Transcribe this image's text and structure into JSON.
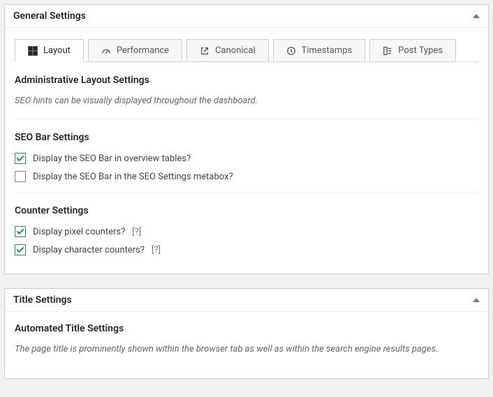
{
  "panels": {
    "general": {
      "title": "General Settings",
      "tabs": [
        {
          "label": "Layout"
        },
        {
          "label": "Performance"
        },
        {
          "label": "Canonical"
        },
        {
          "label": "Timestamps"
        },
        {
          "label": "Post Types"
        }
      ],
      "admin_layout": {
        "heading": "Administrative Layout Settings",
        "desc": "SEO hints can be visually displayed throughout the dashboard."
      },
      "seo_bar": {
        "heading": "SEO Bar Settings",
        "opt1": "Display the SEO Bar in overview tables?",
        "opt2": "Display the SEO Bar in the SEO Settings metabox?"
      },
      "counter": {
        "heading": "Counter Settings",
        "opt1": "Display pixel counters?",
        "opt1_help": "[?]",
        "opt2": "Display character counters?",
        "opt2_help": "[?]"
      }
    },
    "title": {
      "title": "Title Settings",
      "auto": {
        "heading": "Automated Title Settings",
        "desc": "The page title is prominently shown within the browser tab as well as within the search engine results pages."
      }
    }
  }
}
